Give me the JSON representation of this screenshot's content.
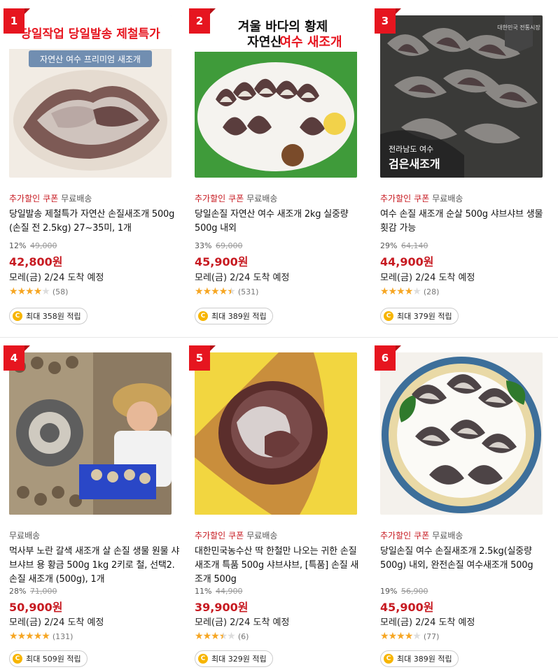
{
  "products": [
    {
      "rank": "1",
      "image_text": [
        "당일작업 당일발송 제철특가",
        "자연산 여수 프리미엄 새조개"
      ],
      "tags": {
        "extra_discount": "추가할인",
        "coupon": "쿠폰",
        "free_shipping": "무료배송"
      },
      "title": "당일발송 제철특가 자연산 손질새조개 500g (손질 전 2.5kg) 27~35미, 1개",
      "discount_rate": "12%",
      "original_price": "49,000",
      "price": "42,800원",
      "delivery": "모레(금) 2/24 도착 예정",
      "rating": 4,
      "review_count": "(58)",
      "reward": "최대 358원 적립"
    },
    {
      "rank": "2",
      "image_text": [
        "겨울 바다의 황제",
        "자연산",
        "여수 새조개"
      ],
      "tags": {
        "extra_discount": "추가할인",
        "coupon": "쿠폰",
        "free_shipping": "무료배송"
      },
      "title": "당일손질 자연산 여수 새조개 2kg 실중량 500g 내외",
      "discount_rate": "33%",
      "original_price": "69,000",
      "price": "45,900원",
      "delivery": "모레(금) 2/24 도착 예정",
      "rating": 4.5,
      "review_count": "(531)",
      "reward": "최대 389원 적립"
    },
    {
      "rank": "3",
      "image_text": [
        "전라남도 여수",
        "검은새조개",
        "대한민국 전통시장"
      ],
      "tags": {
        "extra_discount": "추가할인",
        "coupon": "쿠폰",
        "free_shipping": "무료배송"
      },
      "title": "여수 손질 새조개 순살 500g 샤브샤브 생물 횟감 가능",
      "discount_rate": "29%",
      "original_price": "64,140",
      "price": "44,900원",
      "delivery": "모레(금) 2/24 도착 예정",
      "rating": 4,
      "review_count": "(28)",
      "reward": "최대 379원 적립"
    },
    {
      "rank": "4",
      "image_text": [],
      "tags": {
        "extra_discount": "",
        "coupon": "",
        "free_shipping": "무료배송"
      },
      "title": "먹사부 노란 갈색 새조개 살 손질 생물 원물 샤브샤브 용 황금 500g 1kg 2키로 철, 선택2. 손질 새조개 (500g), 1개",
      "discount_rate": "28%",
      "original_price": "71,000",
      "price": "50,900원",
      "delivery": "모레(금) 2/24 도착 예정",
      "rating": 5,
      "review_count": "(131)",
      "reward": "최대 509원 적립"
    },
    {
      "rank": "5",
      "image_text": [],
      "tags": {
        "extra_discount": "추가할인",
        "coupon": "쿠폰",
        "free_shipping": "무료배송"
      },
      "title": "대한민국농수산 딱 한철만 나오는 귀한 손질 새조개 특품 500g 샤브샤브, [특품] 손질 새조개 500g",
      "discount_rate": "11%",
      "original_price": "44,900",
      "price": "39,900원",
      "delivery": "모레(금) 2/24 도착 예정",
      "rating": 3.5,
      "review_count": "(6)",
      "reward": "최대 329원 적립"
    },
    {
      "rank": "6",
      "image_text": [],
      "tags": {
        "extra_discount": "추가할인",
        "coupon": "쿠폰",
        "free_shipping": "무료배송"
      },
      "title": "당일손질 여수 손질새조개 2.5kg(실중량500g) 내외, 완전손질 여수새조개 500g",
      "discount_rate": "19%",
      "original_price": "56,900",
      "price": "45,900원",
      "delivery": "모레(금) 2/24 도착 예정",
      "rating": 4,
      "review_count": "(77)",
      "reward": "최대 389원 적립"
    }
  ],
  "icons": {
    "reward": "coin-icon",
    "rating": "star-icon"
  },
  "colors": {
    "accent_red": "#c71a21",
    "rank_badge": "#e6151f",
    "star": "#f6a623",
    "coin": "#f7b500"
  }
}
